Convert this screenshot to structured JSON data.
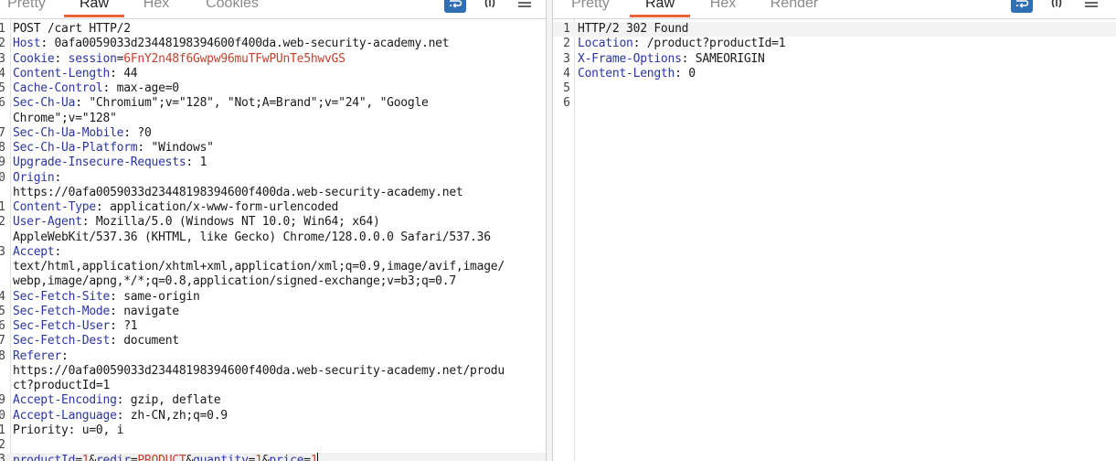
{
  "request_panel": {
    "tabs": [
      {
        "label": "Pretty",
        "active": false
      },
      {
        "label": "Raw",
        "active": true
      },
      {
        "label": "Hex",
        "active": false
      },
      {
        "label": "Cookies",
        "active": false
      }
    ],
    "lines": [
      {
        "n": "1",
        "segs": [
          {
            "t": "POST /cart HTTP/2",
            "c": "hv"
          }
        ]
      },
      {
        "n": "2",
        "segs": [
          {
            "t": "Host",
            "c": "hk"
          },
          {
            "t": ": 0afa0059033d23448198394600f400da.web-security-academy.net",
            "c": "hv"
          }
        ]
      },
      {
        "n": "3",
        "segs": [
          {
            "t": "Cookie",
            "c": "hk"
          },
          {
            "t": ": ",
            "c": "hv"
          },
          {
            "t": "session",
            "c": "ck"
          },
          {
            "t": "=",
            "c": "hv"
          },
          {
            "t": "6FnY2n48f6Gwpw96muTFwPUnTe5hwvGS",
            "c": "cv"
          }
        ]
      },
      {
        "n": "4",
        "segs": [
          {
            "t": "Content-Length",
            "c": "hk"
          },
          {
            "t": ": 44",
            "c": "hv"
          }
        ]
      },
      {
        "n": "5",
        "segs": [
          {
            "t": "Cache-Control",
            "c": "hk"
          },
          {
            "t": ": max-age=0",
            "c": "hv"
          }
        ]
      },
      {
        "n": "6",
        "segs": [
          {
            "t": "Sec-Ch-Ua",
            "c": "hk"
          },
          {
            "t": ": \"Chromium\";v=\"128\", \"Not;A=Brand\";v=\"24\", \"Google",
            "c": "hv"
          }
        ]
      },
      {
        "n": "",
        "segs": [
          {
            "t": "Chrome\";v=\"128\"",
            "c": "hv"
          }
        ]
      },
      {
        "n": "7",
        "segs": [
          {
            "t": "Sec-Ch-Ua-Mobile",
            "c": "hk"
          },
          {
            "t": ": ?0",
            "c": "hv"
          }
        ]
      },
      {
        "n": "8",
        "segs": [
          {
            "t": "Sec-Ch-Ua-Platform",
            "c": "hk"
          },
          {
            "t": ": \"Windows\"",
            "c": "hv"
          }
        ]
      },
      {
        "n": "9",
        "segs": [
          {
            "t": "Upgrade-Insecure-Requests",
            "c": "hk"
          },
          {
            "t": ": 1",
            "c": "hv"
          }
        ]
      },
      {
        "n": "0",
        "segs": [
          {
            "t": "Origin",
            "c": "hk"
          },
          {
            "t": ":",
            "c": "hv"
          }
        ]
      },
      {
        "n": "",
        "segs": [
          {
            "t": "https://0afa0059033d23448198394600f400da.web-security-academy.net",
            "c": "hv"
          }
        ]
      },
      {
        "n": "1",
        "segs": [
          {
            "t": "Content-Type",
            "c": "hk"
          },
          {
            "t": ": application/x-www-form-urlencoded",
            "c": "hv"
          }
        ]
      },
      {
        "n": "2",
        "segs": [
          {
            "t": "User-Agent",
            "c": "hk"
          },
          {
            "t": ": Mozilla/5.0 (Windows NT 10.0; Win64; x64)",
            "c": "hv"
          }
        ]
      },
      {
        "n": "",
        "segs": [
          {
            "t": "AppleWebKit/537.36 (KHTML, like Gecko) Chrome/128.0.0.0 Safari/537.36",
            "c": "hv"
          }
        ]
      },
      {
        "n": "3",
        "segs": [
          {
            "t": "Accept",
            "c": "hk"
          },
          {
            "t": ":",
            "c": "hv"
          }
        ]
      },
      {
        "n": "",
        "segs": [
          {
            "t": "text/html,application/xhtml+xml,application/xml;q=0.9,image/avif,image/",
            "c": "hv"
          }
        ]
      },
      {
        "n": "",
        "segs": [
          {
            "t": "webp,image/apng,*/*;q=0.8,application/signed-exchange;v=b3;q=0.7",
            "c": "hv"
          }
        ]
      },
      {
        "n": "4",
        "segs": [
          {
            "t": "Sec-Fetch-Site",
            "c": "hk"
          },
          {
            "t": ": same-origin",
            "c": "hv"
          }
        ]
      },
      {
        "n": "5",
        "segs": [
          {
            "t": "Sec-Fetch-Mode",
            "c": "hk"
          },
          {
            "t": ": navigate",
            "c": "hv"
          }
        ]
      },
      {
        "n": "6",
        "segs": [
          {
            "t": "Sec-Fetch-User",
            "c": "hk"
          },
          {
            "t": ": ?1",
            "c": "hv"
          }
        ]
      },
      {
        "n": "7",
        "segs": [
          {
            "t": "Sec-Fetch-Dest",
            "c": "hk"
          },
          {
            "t": ": document",
            "c": "hv"
          }
        ]
      },
      {
        "n": "8",
        "segs": [
          {
            "t": "Referer",
            "c": "hk"
          },
          {
            "t": ":",
            "c": "hv"
          }
        ]
      },
      {
        "n": "",
        "segs": [
          {
            "t": "https://0afa0059033d23448198394600f400da.web-security-academy.net/produ",
            "c": "hv"
          }
        ]
      },
      {
        "n": "",
        "segs": [
          {
            "t": "ct?productId=1",
            "c": "hv"
          }
        ]
      },
      {
        "n": "9",
        "segs": [
          {
            "t": "Accept-Encoding",
            "c": "hk"
          },
          {
            "t": ": gzip, deflate",
            "c": "hv"
          }
        ]
      },
      {
        "n": "0",
        "segs": [
          {
            "t": "Accept-Language",
            "c": "hk"
          },
          {
            "t": ": zh-CN,zh;q=0.9",
            "c": "hv"
          }
        ]
      },
      {
        "n": "1",
        "segs": [
          {
            "t": "Priority: u=0, i",
            "c": "hv"
          }
        ]
      },
      {
        "n": "2",
        "segs": []
      },
      {
        "n": "3",
        "highlight": true,
        "caret": true,
        "segs": [
          {
            "t": "productId",
            "c": "pk"
          },
          {
            "t": "=",
            "c": "pe"
          },
          {
            "t": "1",
            "c": "pv"
          },
          {
            "t": "&",
            "c": "pe"
          },
          {
            "t": "redir",
            "c": "pk"
          },
          {
            "t": "=",
            "c": "pe"
          },
          {
            "t": "PRODUCT",
            "c": "pv"
          },
          {
            "t": "&",
            "c": "pe"
          },
          {
            "t": "quantity",
            "c": "pk"
          },
          {
            "t": "=",
            "c": "pe"
          },
          {
            "t": "1",
            "c": "pv"
          },
          {
            "t": "&",
            "c": "pe"
          },
          {
            "t": "price",
            "c": "pk"
          },
          {
            "t": "=",
            "c": "pe"
          },
          {
            "t": "1",
            "c": "pv"
          }
        ]
      }
    ]
  },
  "response_panel": {
    "tabs": [
      {
        "label": "Pretty",
        "active": false
      },
      {
        "label": "Raw",
        "active": true
      },
      {
        "label": "Hex",
        "active": false
      },
      {
        "label": "Render",
        "active": false
      }
    ],
    "lines": [
      {
        "n": "1",
        "current": true,
        "segs": [
          {
            "t": "HTTP/2 302 Found",
            "c": "hv"
          }
        ]
      },
      {
        "n": "2",
        "segs": [
          {
            "t": "Location",
            "c": "hk"
          },
          {
            "t": ": /product?productId=1",
            "c": "hv"
          }
        ]
      },
      {
        "n": "3",
        "segs": [
          {
            "t": "X-Frame-Options",
            "c": "hk"
          },
          {
            "t": ": SAMEORIGIN",
            "c": "hv"
          }
        ]
      },
      {
        "n": "4",
        "segs": [
          {
            "t": "Content-Length",
            "c": "hk"
          },
          {
            "t": ": 0",
            "c": "hv"
          }
        ]
      },
      {
        "n": "5",
        "segs": []
      },
      {
        "n": "6",
        "segs": []
      }
    ]
  },
  "icons": {
    "wrap": "word-wrap-icon",
    "inspector": "inspector-icon",
    "menu": "hamburger-menu-icon"
  },
  "colors": {
    "accent_tab_underline": "#e8633a",
    "header_key": "#2a35a8",
    "param_value": "#c43f2d",
    "wrap_button": "#2f6fb4"
  }
}
